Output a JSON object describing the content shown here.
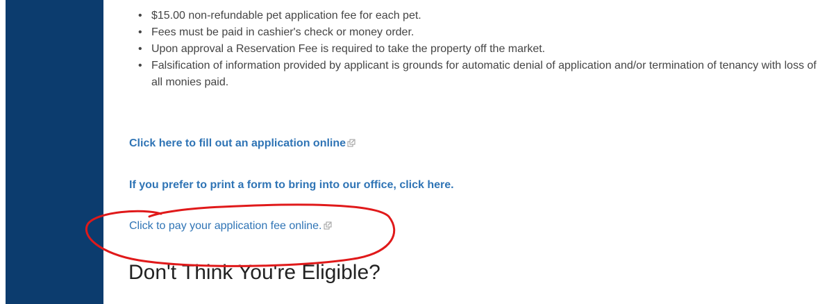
{
  "requirements": [
    "$15.00 non-refundable pet application fee for each pet.",
    "Fees must be paid in cashier's check or money order.",
    "Upon approval a Reservation Fee is required to take the property off the market.",
    "Falsification of information provided by applicant is grounds for automatic denial of application and/or termination of tenancy with loss of all monies paid."
  ],
  "links": {
    "apply_online": "Click here to fill out an application online",
    "print_form": "If you prefer to print a form to bring into our office, click here.",
    "pay_fee": "Click to pay your application fee online."
  },
  "heading": "Don't Think You're Eligible?",
  "colors": {
    "sidebar": "#0c3c6e",
    "link": "#2f74b5",
    "annotation": "#e0191a"
  },
  "icons": {
    "external_link": "external-link-icon"
  }
}
